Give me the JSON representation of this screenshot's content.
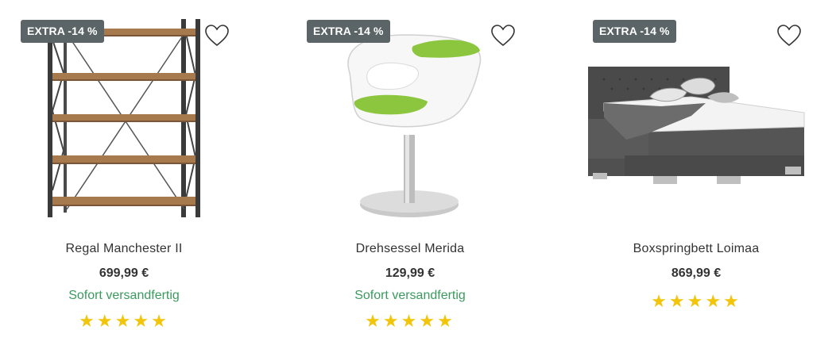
{
  "products": [
    {
      "badge": "EXTRA -14 %",
      "name": "Regal Manchester II",
      "price": "699,99 €",
      "availability": "Sofort versandfertig",
      "rating": 5,
      "image_icon": "shelf-image"
    },
    {
      "badge": "EXTRA -14 %",
      "name": "Drehsessel Merida",
      "price": "129,99 €",
      "availability": "Sofort versandfertig",
      "rating": 5,
      "image_icon": "swivel-chair-image"
    },
    {
      "badge": "EXTRA -14 %",
      "name": "Boxspringbett Loimaa",
      "price": "869,99 €",
      "availability": "",
      "rating": 5,
      "image_icon": "boxspring-bed-image"
    }
  ],
  "colors": {
    "badge_bg": "#5b6466",
    "availability": "#3a9a5e",
    "star": "#f2c40a"
  }
}
